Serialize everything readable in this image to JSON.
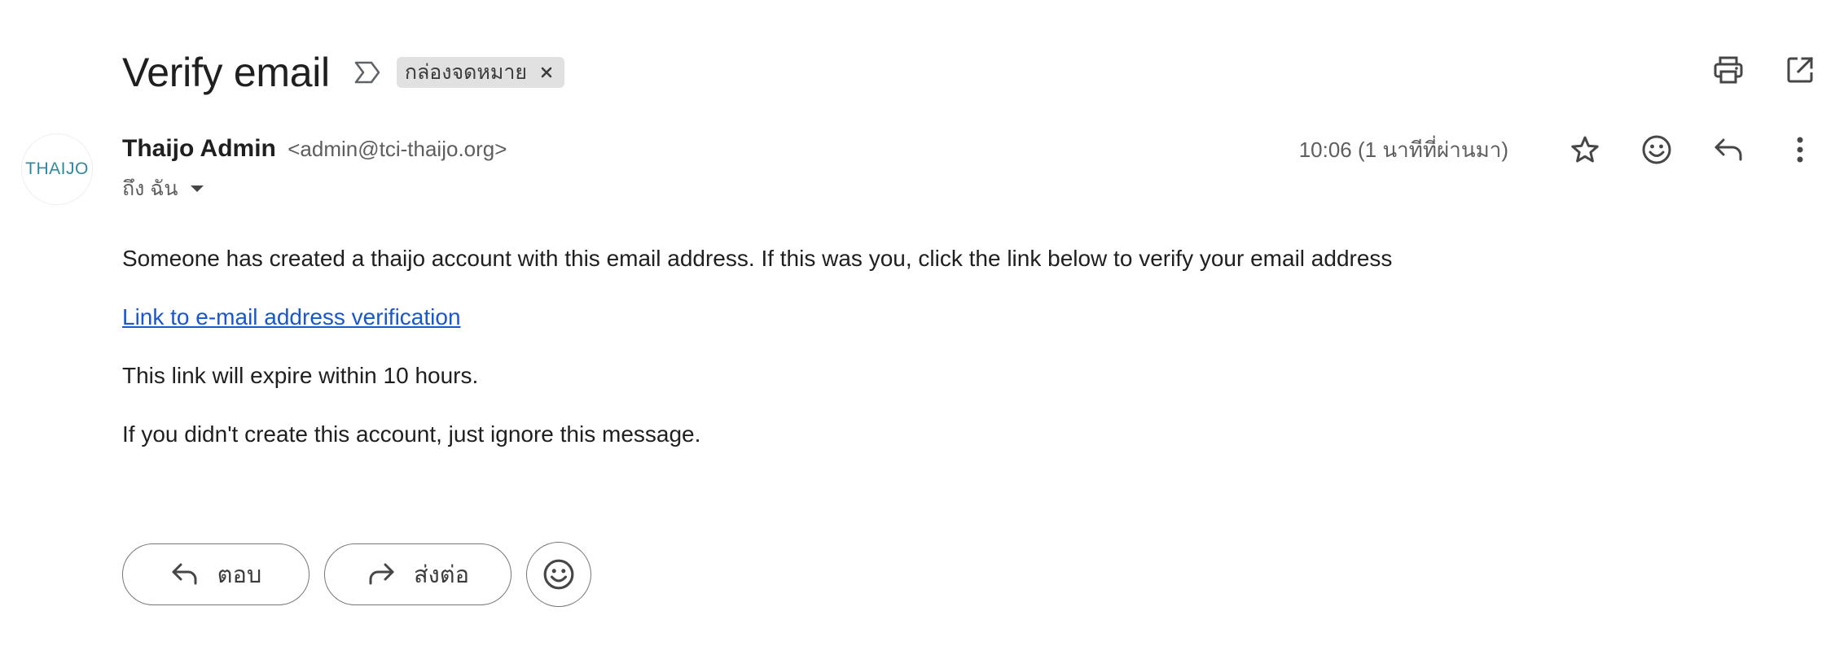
{
  "email": {
    "subject": "Verify email",
    "label_chip": "กล่องจดหมาย",
    "sender_name": "Thaijo Admin",
    "sender_email": "<admin@tci-thaijo.org>",
    "to_line": "ถึง ฉัน",
    "timestamp": "10:06 (1 นาทีที่ผ่านมา)",
    "avatar_text": "THAIJO",
    "body": {
      "paragraph1": "Someone has created a thaijo account with this email address. If this was you, click the link below to verify your email address",
      "link_text": "Link to e-mail address verification",
      "paragraph2": "This link will expire within 10 hours.",
      "paragraph3": "If you didn't create this account, just ignore this message."
    }
  },
  "actions": {
    "reply_label": "ตอบ",
    "forward_label": "ส่งต่อ"
  },
  "icons": {
    "importance": "importance-marker-icon",
    "label_remove": "close-icon",
    "print": "print-icon",
    "open_new_window": "open-in-new-icon",
    "star": "star-icon",
    "emoji": "emoji-icon",
    "reply": "reply-icon",
    "more": "more-vert-icon",
    "caret": "chevron-down-icon",
    "forward": "forward-icon"
  },
  "colors": {
    "link": "#1a56cc",
    "chip_bg": "#e1e1e1",
    "avatar_text": "#2d8a9e"
  }
}
